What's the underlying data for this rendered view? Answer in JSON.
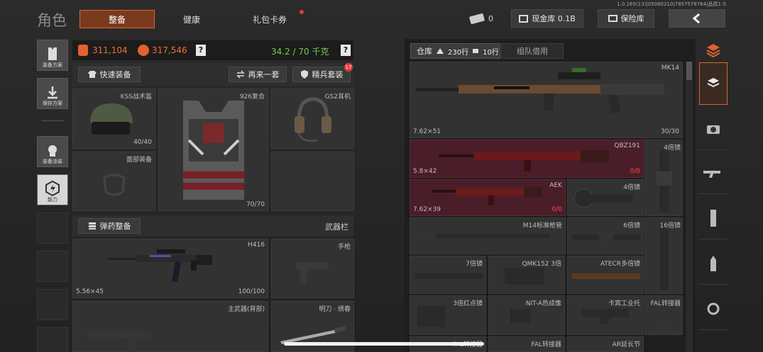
{
  "status_bar": {
    "build": "1.0.165(13)|05080210|7857578764|品质1-5"
  },
  "header": {
    "title": "角色",
    "tabs": [
      {
        "label": "整备",
        "active": true
      },
      {
        "label": "健康"
      },
      {
        "label": "礼包卡券"
      }
    ],
    "ticket_count": "0",
    "cash_vault": "现金库 0.1B",
    "safe_box": "保险库",
    "back_icon": "chevron-left-icon"
  },
  "side_menu": [
    {
      "label": "装备方案",
      "icon": "vest-icon"
    },
    {
      "label": "保存方案",
      "icon": "download-icon"
    },
    {
      "label": "装备涂装",
      "icon": "paint-icon"
    },
    {
      "label": "能力",
      "icon": "ability-icon"
    }
  ],
  "stats": {
    "value1": "311,104",
    "value2": "317,546",
    "help": "?",
    "weight": "34.2 / 70 千克",
    "help2": "?"
  },
  "actions": {
    "quick_equip": "快速装备",
    "again": "再来一套",
    "elite": "精兵套装",
    "elite_badge": "17"
  },
  "gear": {
    "helmet": {
      "name": "KSS战术盔",
      "durability": "40/40"
    },
    "armor": {
      "name": "926复合",
      "durability": "70/70"
    },
    "headset": {
      "name": "GS2耳机"
    },
    "face": {
      "name": "面部装备"
    }
  },
  "ammo_button": "弹药整备",
  "weapon_bar": "武器栏",
  "weapons": {
    "primary": {
      "name": "H416",
      "caliber": "5.56×45",
      "durability": "100/100"
    },
    "pistol": {
      "name": "手枪"
    },
    "main_back": {
      "name": "主武器(背部)"
    },
    "knife": {
      "name": "明刀 · 绣春"
    }
  },
  "warehouse": {
    "tab": "仓库",
    "rows": "230行",
    "rows2": "10行",
    "team": "组队借用"
  },
  "items": [
    {
      "name": "MK14",
      "caliber": "7.62×51",
      "ammo": "30/30"
    },
    {
      "name": "QBZ191",
      "caliber": "5.8×42",
      "ammo": "0/0"
    },
    {
      "name": "AEK",
      "caliber": "7.62×39",
      "ammo": "0/0"
    },
    {
      "name": "4倍镜"
    },
    {
      "name": "4倍镜"
    },
    {
      "name": "M14标准枪管"
    },
    {
      "name": "6倍镜"
    },
    {
      "name": "16倍镜"
    },
    {
      "name": "7倍镜"
    },
    {
      "name": "QMK152 3倍"
    },
    {
      "name": "ATECR多倍镜"
    },
    {
      "name": "3倍红点镜"
    },
    {
      "name": "NIT-A热成像"
    },
    {
      "name": "卡宾工业托"
    },
    {
      "name": "FAL转接器"
    },
    {
      "name": "FAL转接器"
    },
    {
      "name": "FAL转接器"
    },
    {
      "name": "AR延长节"
    }
  ],
  "right_tabs": [
    "stack-icon",
    "box-icon",
    "camera-icon",
    "rifle-icon",
    "magazine-icon",
    "bullet-icon",
    "scope-icon"
  ],
  "colors": {
    "accent": "#e2622e",
    "weight_green": "#6fd04a",
    "red_item": "#4a1e28",
    "ammo_red": "#ff4b4b"
  }
}
